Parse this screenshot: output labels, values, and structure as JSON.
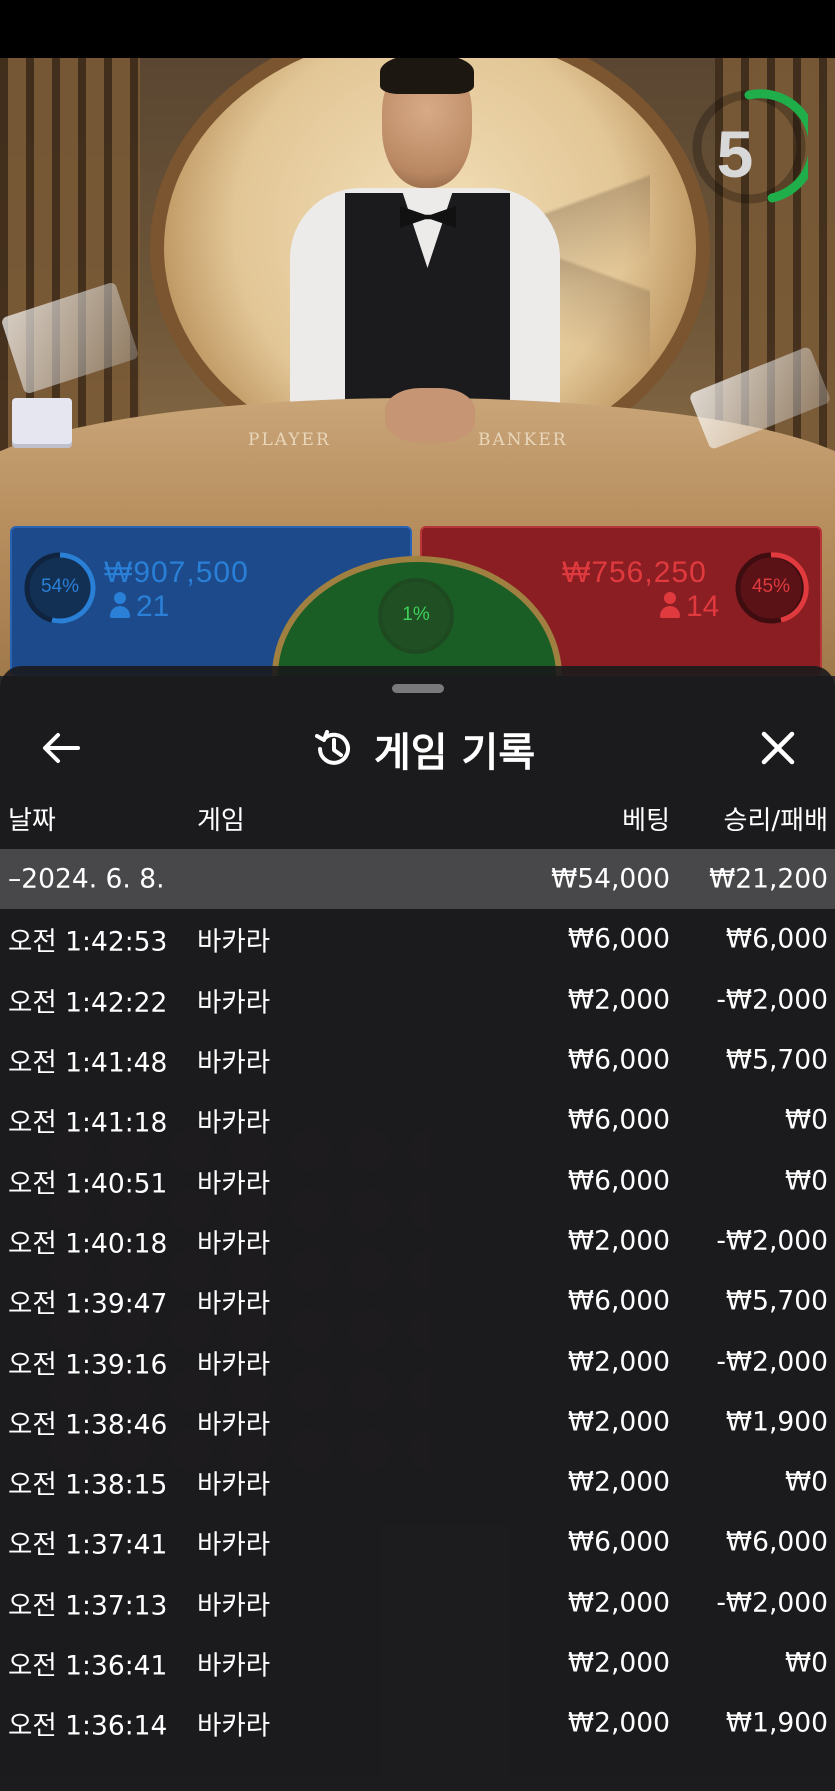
{
  "video": {
    "timer": "5",
    "player_label": "PLAYER",
    "banker_label": "BANKER"
  },
  "bets": {
    "player": {
      "percent": "54%",
      "stake": "₩907,500",
      "count": "21",
      "color": "#2a7fd6"
    },
    "banker": {
      "percent": "45%",
      "stake": "₩756,250",
      "count": "14",
      "color": "#e03a3f"
    },
    "tie": {
      "percent": "1%",
      "color": "#3ed05a"
    }
  },
  "history": {
    "title": "게임 기록",
    "columns": {
      "date": "날짜",
      "game": "게임",
      "bet": "베팅",
      "result": "승리/패배"
    },
    "summary": {
      "date": "–2024. 6. 8.",
      "bet": "₩54,000",
      "result": "₩21,200"
    },
    "rows": [
      {
        "time": "오전 1:42:53",
        "game": "바카라",
        "bet": "₩6,000",
        "result": "₩6,000"
      },
      {
        "time": "오전 1:42:22",
        "game": "바카라",
        "bet": "₩2,000",
        "result": "-₩2,000"
      },
      {
        "time": "오전 1:41:48",
        "game": "바카라",
        "bet": "₩6,000",
        "result": "₩5,700"
      },
      {
        "time": "오전 1:41:18",
        "game": "바카라",
        "bet": "₩6,000",
        "result": "₩0"
      },
      {
        "time": "오전 1:40:51",
        "game": "바카라",
        "bet": "₩6,000",
        "result": "₩0"
      },
      {
        "time": "오전 1:40:18",
        "game": "바카라",
        "bet": "₩2,000",
        "result": "-₩2,000"
      },
      {
        "time": "오전 1:39:47",
        "game": "바카라",
        "bet": "₩6,000",
        "result": "₩5,700"
      },
      {
        "time": "오전 1:39:16",
        "game": "바카라",
        "bet": "₩2,000",
        "result": "-₩2,000"
      },
      {
        "time": "오전 1:38:46",
        "game": "바카라",
        "bet": "₩2,000",
        "result": "₩1,900"
      },
      {
        "time": "오전 1:38:15",
        "game": "바카라",
        "bet": "₩2,000",
        "result": "₩0"
      },
      {
        "time": "오전 1:37:41",
        "game": "바카라",
        "bet": "₩6,000",
        "result": "₩6,000"
      },
      {
        "time": "오전 1:37:13",
        "game": "바카라",
        "bet": "₩2,000",
        "result": "-₩2,000"
      },
      {
        "time": "오전 1:36:41",
        "game": "바카라",
        "bet": "₩2,000",
        "result": "₩0"
      },
      {
        "time": "오전 1:36:14",
        "game": "바카라",
        "bet": "₩2,000",
        "result": "₩1,900"
      }
    ]
  }
}
